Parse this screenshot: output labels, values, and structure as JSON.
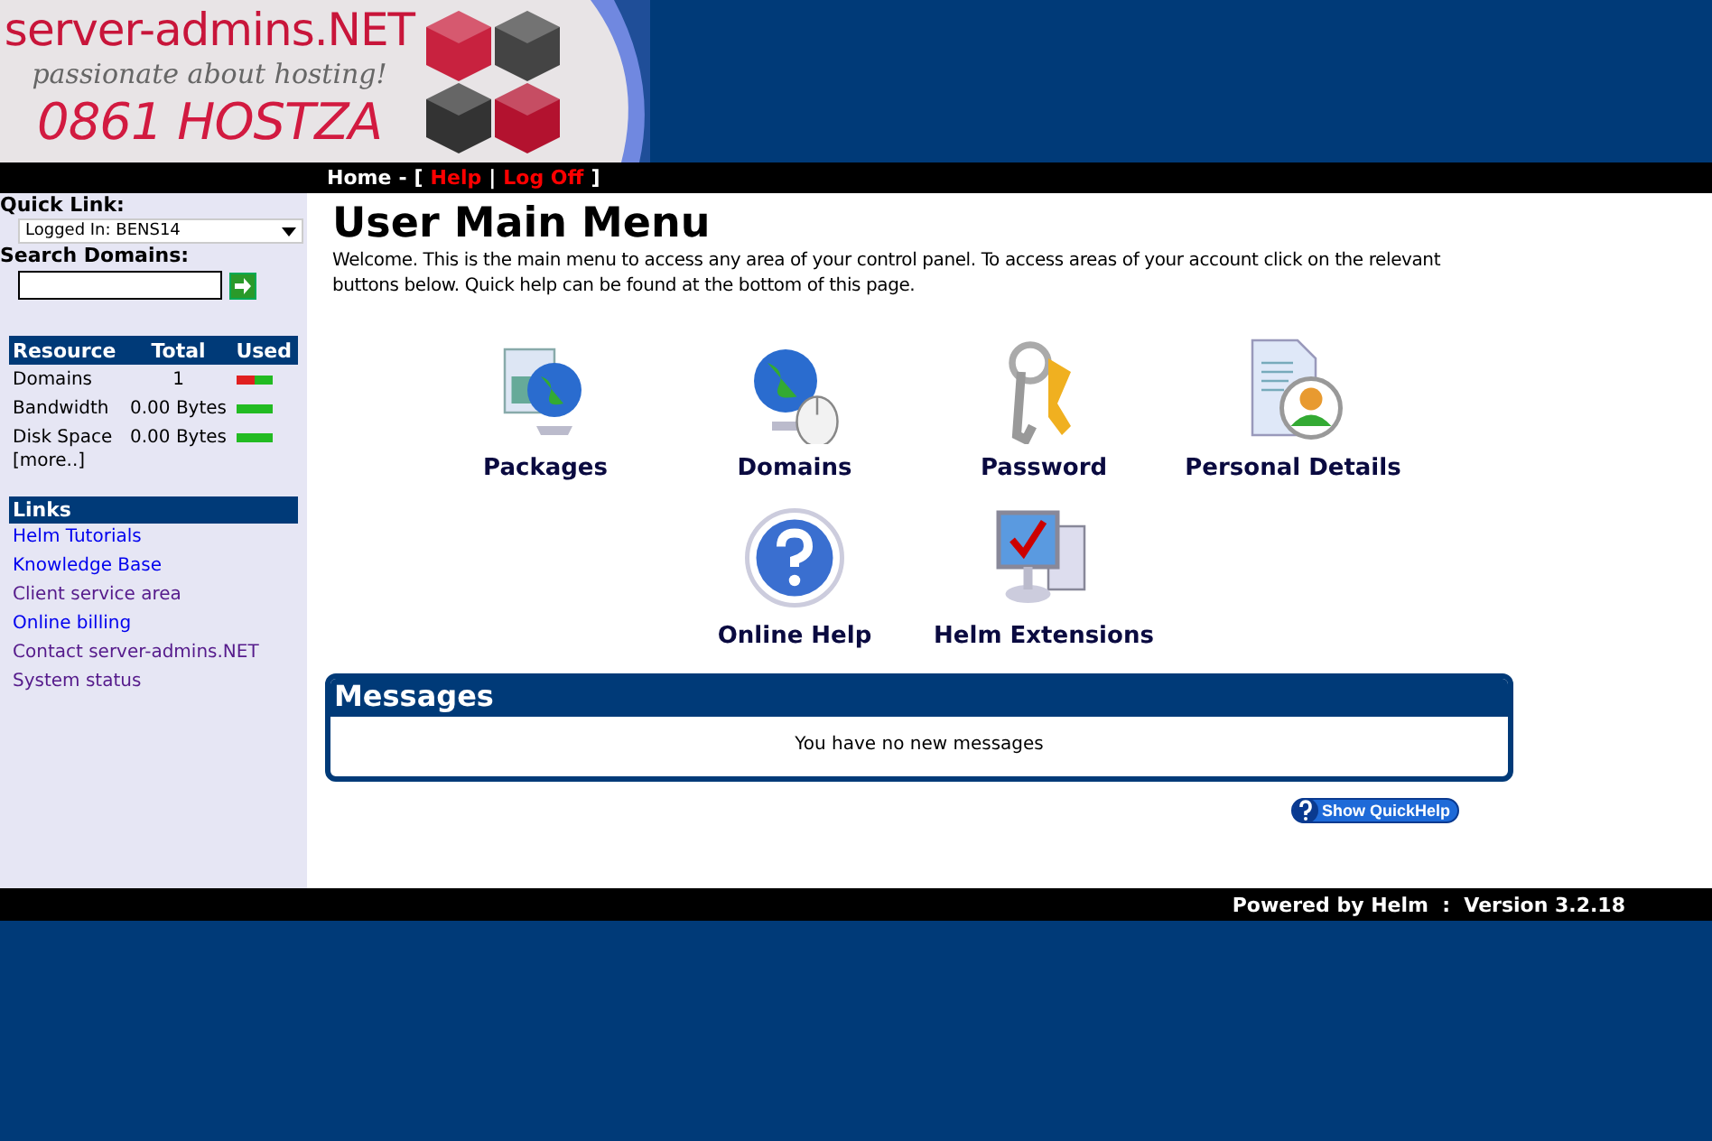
{
  "logo": {
    "name": "server-admins.NET",
    "tagline": "passionate about hosting!",
    "phone": "0861 HOSTZA"
  },
  "nav": [
    {
      "text": "Home",
      "kind": "link"
    },
    {
      "text": "-",
      "kind": "text"
    },
    {
      "text": "[",
      "kind": "text"
    },
    {
      "text": "Help",
      "kind": "alert-link"
    },
    {
      "text": "|",
      "kind": "text"
    },
    {
      "text": "Log Off",
      "kind": "alert-link"
    },
    {
      "text": "]",
      "kind": "text"
    }
  ],
  "sidebar": {
    "quick_link": {
      "label": "Quick Link:",
      "value": "Logged In: BENS14"
    },
    "search": {
      "label": "Search Domains:"
    },
    "resources": {
      "columns": [
        "Resource",
        "Total",
        "Used"
      ],
      "rows": [
        {
          "name": "Domains",
          "total": "1",
          "level": 0.5
        },
        {
          "name": "Bandwidth",
          "total": "0.00 Bytes",
          "level": 0
        },
        {
          "name": "Disk Space",
          "total": "0.00 Bytes",
          "level": 0
        }
      ],
      "more": "[more..]"
    },
    "links": {
      "title": "Links",
      "items": [
        {
          "text": "Helm Tutorials",
          "visited": false
        },
        {
          "text": "Knowledge Base",
          "visited": false
        },
        {
          "text": "Client service area",
          "visited": true
        },
        {
          "text": "Online billing",
          "visited": false
        },
        {
          "text": "Contact server-admins.NET",
          "visited": true
        },
        {
          "text": "System status",
          "visited": true
        }
      ]
    }
  },
  "main": {
    "title": "User Main Menu",
    "intro": "Welcome. This is the main menu to access any area of your control panel. To access areas of your account click on the relevant buttons below. Quick help can be found at the bottom of this page.",
    "menu": [
      {
        "label": "Packages",
        "kind": "packages"
      },
      {
        "label": "Domains",
        "kind": "domains"
      },
      {
        "label": "Password",
        "kind": "password"
      },
      {
        "label": "Personal Details",
        "kind": "personal"
      },
      {
        "label": "Online Help",
        "kind": "help"
      },
      {
        "label": "Helm Extensions",
        "kind": "extensions"
      }
    ],
    "messages": {
      "title": "Messages",
      "text": "You have no new messages"
    },
    "quickhelp": "Show QuickHelp"
  },
  "footer": {
    "text": "Powered by Helm  :  Version 3.2.18"
  }
}
